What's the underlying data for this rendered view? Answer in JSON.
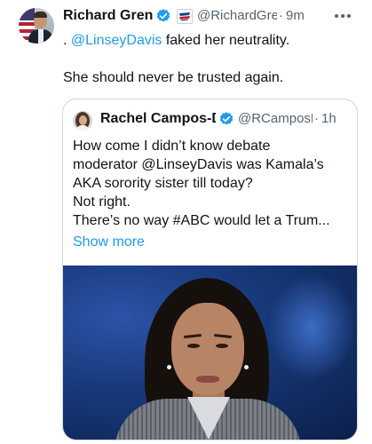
{
  "tweet": {
    "author": {
      "name": "Richard Grenell",
      "handle": "@RichardGrenell",
      "time": "9m",
      "dot": "·"
    },
    "text": {
      "line1_prefix": ". ",
      "mention": "@LinseyDavis",
      "line1_suffix": " faked her neutrality.",
      "line2": "She should never be trusted again."
    }
  },
  "quote": {
    "author": {
      "name": "Rachel Campos-Duffy",
      "handle": "@RCamposDuffy",
      "time": "1h",
      "dot": "·"
    },
    "lines": [
      "How come I didn’t know debate",
      "moderator @LinseyDavis was Kamala’s",
      "AKA sorority sister till today?",
      "Not right.",
      "There’s no way #ABC would let a Trum..."
    ],
    "show_more": "Show more"
  },
  "colors": {
    "accent": "#1d9bf0",
    "secondary_text": "#536471",
    "border": "#cfd9de"
  },
  "icons": [
    "verified-badge-icon",
    "organization-badge-icon",
    "more-options-icon"
  ]
}
